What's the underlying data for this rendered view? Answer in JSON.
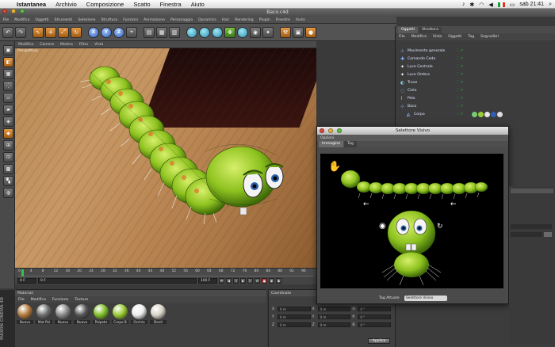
{
  "menubar": {
    "app": "Istantanea",
    "items": [
      "Archivio",
      "Composizione",
      "Scatto",
      "Finestra",
      "Aiuto"
    ],
    "clock": "sab 21:41"
  },
  "window": {
    "title": "Baco.c4d"
  },
  "app_menu": [
    "File",
    "Modifica",
    "Oggetti",
    "Strumenti",
    "Selezione",
    "Struttura",
    "Funzioni",
    "Animazione",
    "Personaggio",
    "Dynamics",
    "Hair",
    "Rendering",
    "Plugin",
    "Finestre",
    "Aiuto"
  ],
  "toolbar": {
    "axis_labels": [
      "X",
      "Y",
      "Z"
    ]
  },
  "viewport": {
    "menu": [
      "Modifica",
      "Camere",
      "Mostra",
      "Filtro",
      "Vista"
    ],
    "label": "Prospettiva"
  },
  "timeline": {
    "ticks": [
      "0",
      "4",
      "8",
      "12",
      "16",
      "20",
      "24",
      "28",
      "32",
      "36",
      "40",
      "44",
      "48",
      "52",
      "56",
      "60",
      "64",
      "68",
      "72",
      "76",
      "80",
      "84",
      "88",
      "92",
      "96"
    ],
    "current_frame": "0 F",
    "start_frame": "0 F",
    "end_frame": "100 F"
  },
  "materials": {
    "title": "Materiali",
    "menu": [
      "File",
      "Modifica",
      "Funzione",
      "Texture"
    ],
    "items": [
      {
        "label": "Nuovo",
        "color": "#b27a3f"
      },
      {
        "label": "Mat Pel",
        "color": "#6f6f6f"
      },
      {
        "label": "Nuovo",
        "color": "#8a8a8a"
      },
      {
        "label": "Nuovo",
        "color": "#555555"
      },
      {
        "label": "Palpebr",
        "color": "#7fbf2a"
      },
      {
        "label": "Corpo B",
        "color": "#9acb33"
      },
      {
        "label": "Occhio",
        "color": "#eeeeee"
      },
      {
        "label": "Denti",
        "color": "#d9d4c8"
      }
    ],
    "brand": "MAXON CINEMA 4D"
  },
  "coordinates": {
    "title": "Coordinate",
    "rows": [
      {
        "axis": "X",
        "pos": "0 m",
        "size": "0 m",
        "rot_axis": "H",
        "rot": "0 °"
      },
      {
        "axis": "Y",
        "pos": "0 m",
        "size": "0 m",
        "rot_axis": "P",
        "rot": "0 °"
      },
      {
        "axis": "Z",
        "pos": "0 m",
        "size": "0 m",
        "rot_axis": "B",
        "rot": "0 °"
      }
    ],
    "apply_label": "Applica"
  },
  "objects": {
    "tabs": [
      "Oggetti",
      "Struttura"
    ],
    "menu": [
      "File",
      "Modifica",
      "Vista",
      "Oggetti",
      "Tag",
      "Segnalibri"
    ],
    "items": [
      {
        "name": "Movimento generale",
        "color": "#8ab4ff"
      },
      {
        "name": "Comando Coda",
        "color": "#8ab4ff"
      },
      {
        "name": "Luce Centrale",
        "color": "#ffffff"
      },
      {
        "name": "Luce Ombra",
        "color": "#ffffff"
      },
      {
        "name": "Trave",
        "color": "#7fd0e0"
      },
      {
        "name": "Cielo",
        "color": "#7fd0e0"
      },
      {
        "name": "Pelo",
        "color": "#b0e070"
      },
      {
        "name": "Baco",
        "color": "#8ab4ff"
      },
      {
        "name": "Corpo",
        "color": "#8ab4ff"
      }
    ]
  },
  "dialog": {
    "title": "Selettore Visivo",
    "menu": "Opzioni",
    "tabs": [
      "Immagine",
      "Tag"
    ],
    "footer_label": "Tag Attuale",
    "footer_value": "Selettore Visivo"
  },
  "colors": {
    "body_green": "#8dc21f",
    "accent_blue": "#2e5fb7"
  }
}
